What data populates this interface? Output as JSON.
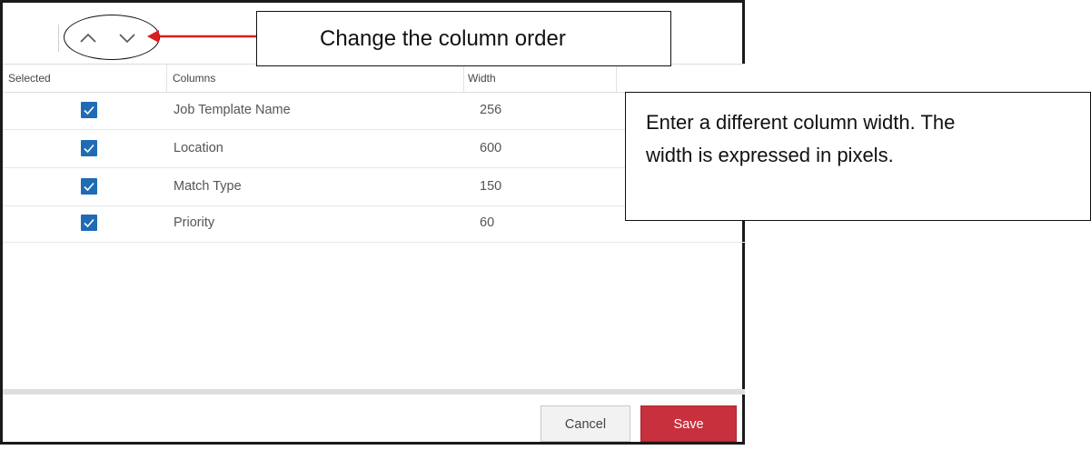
{
  "toolbar": {
    "move_up_icon": "chevron-up-icon",
    "move_down_icon": "chevron-down-icon"
  },
  "columns_header": {
    "selected": "Selected",
    "columns": "Columns",
    "width": "Width"
  },
  "rows": [
    {
      "selected": true,
      "name": "Job Template Name",
      "width": "256"
    },
    {
      "selected": true,
      "name": "Location",
      "width": "600"
    },
    {
      "selected": true,
      "name": "Match Type",
      "width": "150"
    },
    {
      "selected": true,
      "name": "Priority",
      "width": "60"
    }
  ],
  "footer": {
    "cancel_label": "Cancel",
    "save_label": "Save"
  },
  "annotations": {
    "column_order_note": "Change the column order",
    "width_note_line1": "Enter a different column width.  The",
    "width_note_line2": "width is expressed in pixels."
  },
  "colors": {
    "checkbox": "#1f6bb5",
    "save_button": "#c8303e",
    "arrow": "#d81e1e"
  }
}
